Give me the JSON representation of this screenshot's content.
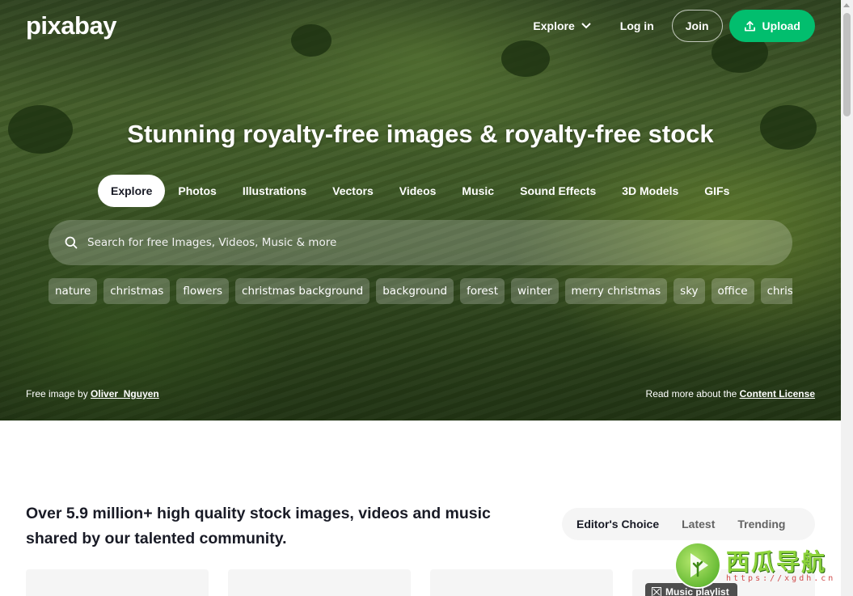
{
  "header": {
    "logo": "pixabay",
    "nav": {
      "explore": "Explore",
      "login": "Log in",
      "join": "Join",
      "upload": "Upload"
    }
  },
  "hero": {
    "headline": "Stunning royalty-free images & royalty-free stock",
    "tabs": [
      {
        "label": "Explore",
        "active": true
      },
      {
        "label": "Photos"
      },
      {
        "label": "Illustrations"
      },
      {
        "label": "Vectors"
      },
      {
        "label": "Videos"
      },
      {
        "label": "Music"
      },
      {
        "label": "Sound Effects"
      },
      {
        "label": "3D Models"
      },
      {
        "label": "GIFs"
      }
    ],
    "search": {
      "placeholder": "Search for free Images, Videos, Music & more"
    },
    "tags": [
      "nature",
      "christmas",
      "flowers",
      "christmas background",
      "background",
      "forest",
      "winter",
      "merry christmas",
      "sky",
      "office",
      "christm"
    ],
    "credit": {
      "prefix": "Free image by",
      "author": "Oliver_Nguyen"
    },
    "license": {
      "prefix": "Read more about the",
      "link": "Content License"
    }
  },
  "content": {
    "intro": "Over 5.9 million+ high quality stock images, videos and music shared by our talented community.",
    "sort_tabs": [
      {
        "label": "Editor's Choice",
        "active": true
      },
      {
        "label": "Latest"
      },
      {
        "label": "Trending"
      }
    ],
    "music_badge": "Music playlist"
  },
  "watermark": {
    "title": "西瓜导航",
    "url": "https://xgdh.cn"
  },
  "colors": {
    "upload_green": "#02be6e",
    "text_dark": "#191b26"
  }
}
